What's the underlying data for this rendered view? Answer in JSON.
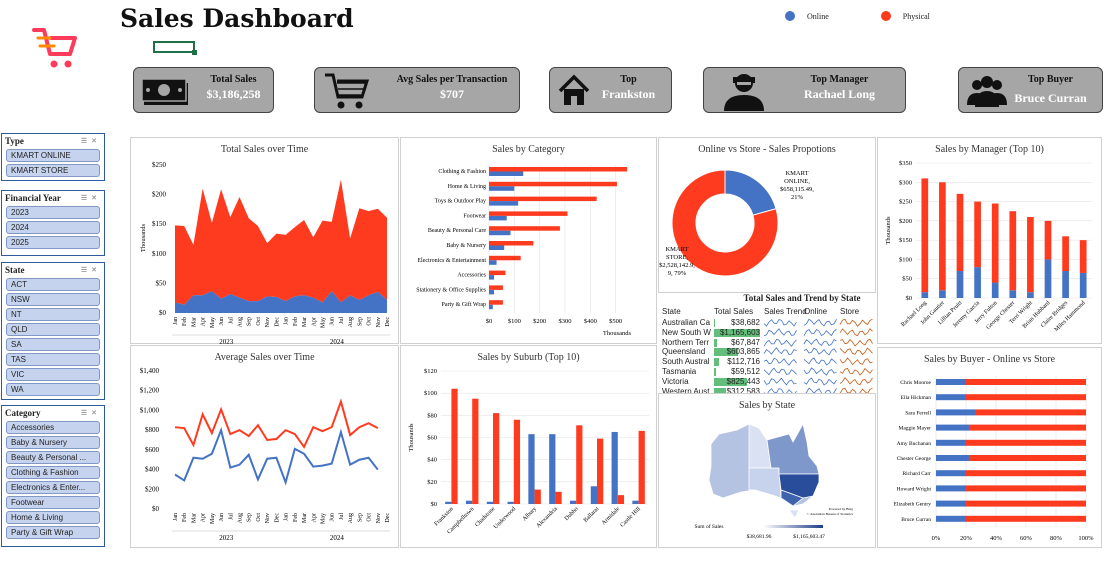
{
  "header": {
    "title": "Sales Dashboard"
  },
  "legend": {
    "online_label": "Online",
    "physical_label": "Physical",
    "online_color": "#4472c4",
    "physical_color": "#ff3b1f"
  },
  "kpis": [
    {
      "label": "Total Sales",
      "value": "$3,186,258",
      "icon": "money-icon"
    },
    {
      "label": "Avg Sales per Transaction",
      "value": "$707",
      "icon": "cart-icon"
    },
    {
      "label": "Top",
      "value": "Frankston",
      "icon": "house-icon"
    },
    {
      "label": "Top Manager",
      "value": "Rachael Long",
      "icon": "manager-icon"
    },
    {
      "label": "Top Buyer",
      "value": "Bruce Curran",
      "icon": "people-icon"
    }
  ],
  "slicers": {
    "type": {
      "title": "Type",
      "items": [
        "KMART ONLINE",
        "KMART STORE"
      ]
    },
    "year": {
      "title": "Financial Year",
      "items": [
        "2023",
        "2024",
        "2025"
      ]
    },
    "state": {
      "title": "State",
      "items": [
        "ACT",
        "NSW",
        "NT",
        "QLD",
        "SA",
        "TAS",
        "VIC",
        "WA"
      ]
    },
    "category": {
      "title": "Category",
      "items": [
        "Accessories",
        "Baby & Nursery",
        "Beauty & Personal ...",
        "Clothing & Fashion",
        "Electronics & Enter...",
        "Footwear",
        "Home & Living",
        "Party & Gift Wrap"
      ]
    }
  },
  "panels": {
    "time": "Total Sales over Time",
    "category": "Sales by Category",
    "propo": "Online vs Store - Sales Propotions",
    "manager": "Sales by Manager (Top 10)",
    "avg": "Average Sales over Time",
    "suburb": "Sales by Suburb (Top 10)",
    "state_map": "Sales by State",
    "buyer": "Sales by Buyer - Online vs Store"
  },
  "state_table": {
    "title": "Total Sales and Trend by State",
    "headers": [
      "State",
      "Total Sales",
      "Sales Trend",
      "Online",
      "Store"
    ],
    "rows": [
      {
        "state": "Australian Ca",
        "total": "$38,682",
        "share": 0.03
      },
      {
        "state": "New South W",
        "total": "$1,165,603",
        "share": 1.0
      },
      {
        "state": "Northern Terr",
        "total": "$67,847",
        "share": 0.06
      },
      {
        "state": "Queensland",
        "total": "$603,865",
        "share": 0.52
      },
      {
        "state": "South Austral",
        "total": "$112,716",
        "share": 0.1
      },
      {
        "state": "Tasmania",
        "total": "$59,512",
        "share": 0.05
      },
      {
        "state": "Victoria",
        "total": "$825,443",
        "share": 0.71
      },
      {
        "state": "Western Aust",
        "total": "$312,583",
        "share": 0.27
      }
    ]
  },
  "map": {
    "legend_title": "Sum of Sales",
    "min_label": "$38,681.96",
    "max_label": "$1,165,603.47",
    "credit_1": "Powered by Bing",
    "credit_2": "© Australian Bureau of Statistics"
  },
  "chart_data": [
    {
      "id": "total-sales-over-time",
      "type": "area",
      "title": "Total Sales over Time",
      "ylabel": "Thousands",
      "ylim": [
        0,
        250
      ],
      "yticks": [
        "$0",
        "$50",
        "$100",
        "$150",
        "$200",
        "$250"
      ],
      "x": [
        "Jan",
        "Feb",
        "Mar",
        "Apr",
        "May",
        "Jun",
        "Jul",
        "Aug",
        "Sep",
        "Oct",
        "Nov",
        "Dec",
        "Jan",
        "Feb",
        "Mar",
        "Apr",
        "May",
        "Jun",
        "Jul",
        "Aug",
        "Sep",
        "Oct",
        "Nov",
        "Dec"
      ],
      "groups": [
        "2023",
        "2024"
      ],
      "series": [
        {
          "name": "Online",
          "values": [
            18,
            14,
            30,
            30,
            37,
            24,
            32,
            26,
            20,
            20,
            28,
            27,
            20,
            28,
            30,
            26,
            18,
            37,
            18,
            30,
            22,
            30,
            36,
            22
          ]
        },
        {
          "name": "Physical",
          "values": [
            130,
            133,
            85,
            180,
            115,
            185,
            130,
            170,
            140,
            127,
            90,
            107,
            112,
            117,
            127,
            102,
            138,
            117,
            207,
            96,
            155,
            142,
            140,
            139
          ]
        }
      ]
    },
    {
      "id": "sales-by-category",
      "type": "bar",
      "title": "Sales by Category",
      "xlabel": "Thousands",
      "xlim": [
        0,
        600
      ],
      "xticks": [
        "$0",
        "$100",
        "$200",
        "$300",
        "$400",
        "$500"
      ],
      "categories": [
        "Clothing & Fashion",
        "Home & Living",
        "Toys & Outdoor Play",
        "Footwear",
        "Beauty & Personal Care",
        "Baby & Nursery",
        "Electronics & Entertainment",
        "Accessories",
        "Stationery & Office Supplies",
        "Party & Gift Wrap"
      ],
      "series": [
        {
          "name": "Physical",
          "values": [
            545,
            505,
            425,
            310,
            280,
            175,
            125,
            65,
            55,
            55
          ]
        },
        {
          "name": "Online",
          "values": [
            135,
            100,
            115,
            70,
            85,
            60,
            30,
            20,
            20,
            15
          ]
        }
      ]
    },
    {
      "id": "online-vs-store",
      "type": "pie",
      "title": "Online vs Store - Sales Propotions",
      "labels": [
        "KMART ONLINE",
        "KMART STORE"
      ],
      "values": [
        658115.49,
        2528142.9
      ],
      "percent_labels": [
        "21%",
        "79%"
      ],
      "value_labels": [
        "$658,115.49,",
        "$2,528,142.9,"
      ]
    },
    {
      "id": "sales-by-manager",
      "type": "bar",
      "title": "Sales by Manager (Top 10)",
      "ylabel": "Thousands",
      "ylim": [
        0,
        350
      ],
      "yticks": [
        "$0",
        "$50",
        "$100",
        "$150",
        "$200",
        "$250",
        "$300",
        "$350"
      ],
      "categories": [
        "Rachael Long",
        "John Gautier",
        "Lillian Pruitt",
        "Jeremy Garcia",
        "Jerry Fulton",
        "George Chester",
        "Terri Wright",
        "Brian Hubbard",
        "Claire Bridges",
        "Miles Hammond"
      ],
      "series": [
        {
          "name": "Online",
          "values": [
            15,
            20,
            70,
            80,
            40,
            20,
            15,
            100,
            70,
            65
          ]
        },
        {
          "name": "Physical",
          "values": [
            295,
            280,
            200,
            170,
            205,
            205,
            195,
            100,
            90,
            85
          ]
        }
      ]
    },
    {
      "id": "average-sales-over-time",
      "type": "line",
      "title": "Average Sales over Time",
      "ylim": [
        0,
        1400
      ],
      "yticks": [
        "$0",
        "$200",
        "$400",
        "$600",
        "$800",
        "$1,000",
        "$1,200",
        "$1,400"
      ],
      "x": [
        "Jan",
        "Feb",
        "Mar",
        "Apr",
        "May",
        "Jun",
        "Jul",
        "Aug",
        "Sep",
        "Oct",
        "Nov",
        "Dec",
        "Jan",
        "Feb",
        "Mar",
        "Apr",
        "May",
        "Jun",
        "Jul",
        "Aug",
        "Sep",
        "Oct",
        "Nov",
        "Dec"
      ],
      "groups": [
        "2023",
        "2024"
      ],
      "series": [
        {
          "name": "Online",
          "values": [
            350,
            290,
            520,
            510,
            560,
            800,
            420,
            450,
            550,
            300,
            510,
            520,
            270,
            610,
            560,
            430,
            440,
            460,
            780,
            450,
            500,
            520,
            400,
            0
          ]
        },
        {
          "name": "Physical",
          "values": [
            830,
            820,
            650,
            960,
            770,
            1010,
            760,
            800,
            740,
            850,
            700,
            710,
            800,
            760,
            630,
            830,
            790,
            830,
            1090,
            750,
            830,
            870,
            820,
            0
          ]
        }
      ]
    },
    {
      "id": "sales-by-suburb",
      "type": "bar",
      "title": "Sales by Suburb (Top 10)",
      "ylabel": "Thousands",
      "ylim": [
        0,
        120
      ],
      "yticks": [
        "$0",
        "$20",
        "$40",
        "$60",
        "$80",
        "$100",
        "$120"
      ],
      "categories": [
        "Frankston",
        "Campbelltown",
        "Chadstone",
        "Underwood",
        "Albury",
        "Alexandria",
        "Dubbo",
        "Ballarat",
        "Armidale",
        "Castle Hill"
      ],
      "series": [
        {
          "name": "Online",
          "values": [
            2,
            3,
            2,
            2,
            63,
            63,
            3,
            16,
            65,
            3
          ]
        },
        {
          "name": "Physical",
          "values": [
            104,
            95,
            82,
            76,
            13,
            11,
            71,
            59,
            8,
            66
          ]
        }
      ]
    },
    {
      "id": "sales-by-buyer",
      "type": "bar",
      "title": "Sales by Buyer - Online vs Store",
      "xticks": [
        "0%",
        "20%",
        "40%",
        "60%",
        "80%",
        "100%"
      ],
      "categories": [
        "Chris Monroe",
        "Ella Hickman",
        "Sara Ferrell",
        "Maggie Mayer",
        "Amy Buchanan",
        "Chester George",
        "Richard Carr",
        "Howard Wright",
        "Elizabeth Gentry",
        "Bruce Curran"
      ],
      "series": [
        {
          "name": "Online",
          "values": [
            0.2,
            0.2,
            0.26,
            0.22,
            0.2,
            0.22,
            0.2,
            0.2,
            0.2,
            0.2
          ]
        },
        {
          "name": "Physical",
          "values": [
            0.8,
            0.8,
            0.74,
            0.78,
            0.8,
            0.78,
            0.8,
            0.8,
            0.8,
            0.8
          ]
        }
      ]
    }
  ]
}
